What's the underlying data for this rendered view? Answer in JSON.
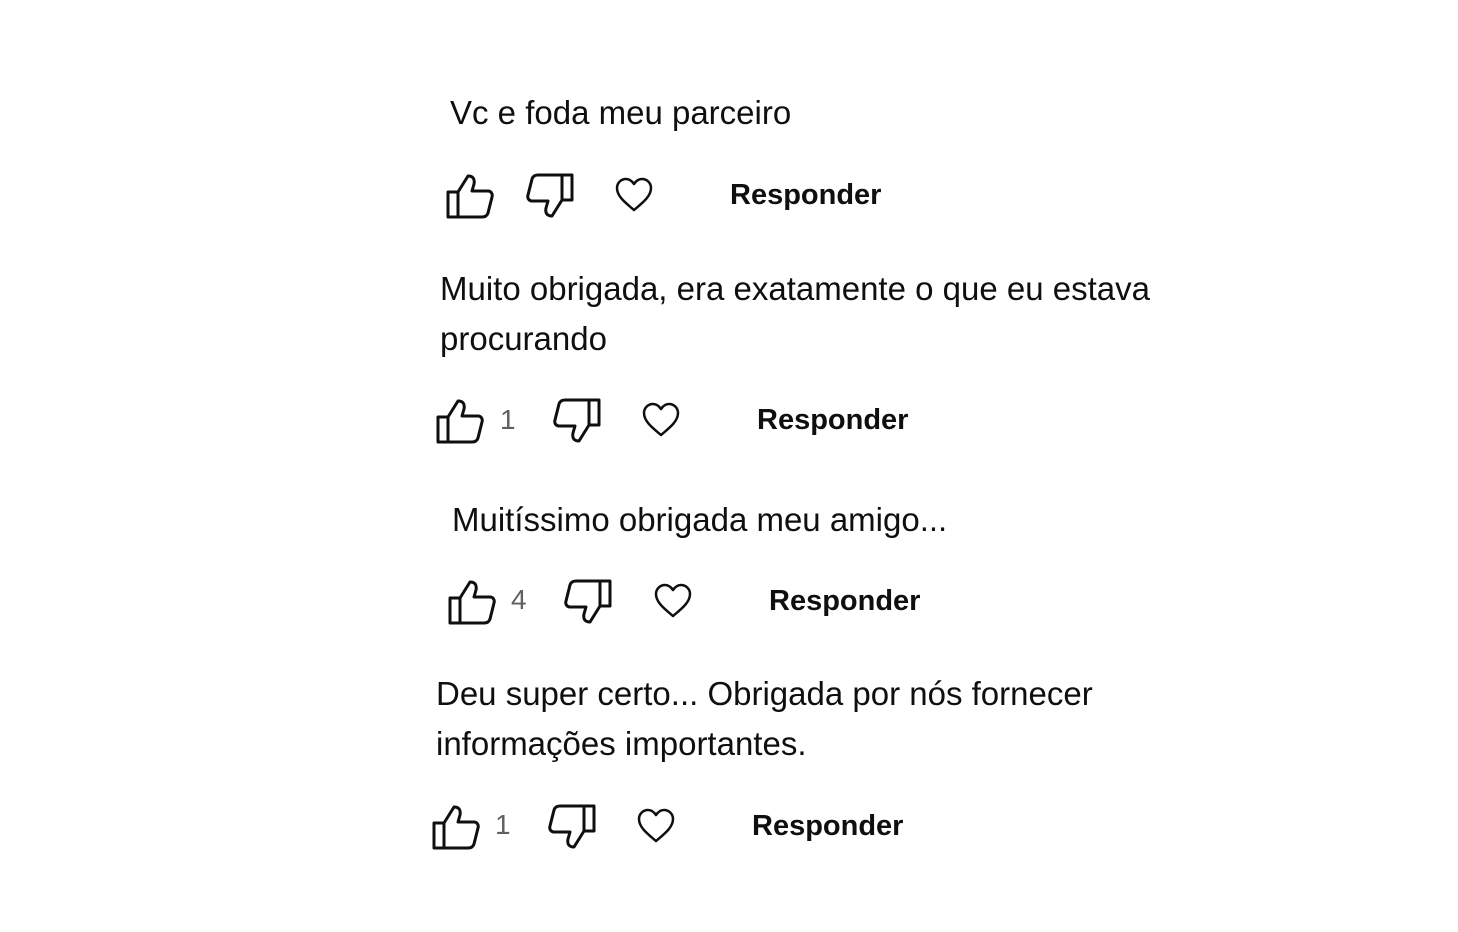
{
  "comments": [
    {
      "text_lines": [
        "Vc e foda meu parceiro"
      ],
      "like_count": "",
      "reply_label": "Responder"
    },
    {
      "text_lines": [
        "Muito obrigada, era exatamente o que eu estava",
        "procurando"
      ],
      "like_count": "1",
      "reply_label": "Responder"
    },
    {
      "text_lines": [
        "Muitíssimo obrigada meu amigo..."
      ],
      "like_count": "4",
      "reply_label": "Responder"
    },
    {
      "text_lines": [
        "Deu super certo... Obrigada por nós fornecer",
        "informações importantes."
      ],
      "like_count": "1",
      "reply_label": "Responder"
    }
  ],
  "icons": {
    "like": "thumbs-up-icon",
    "dislike": "thumbs-down-icon",
    "heart": "heart-icon"
  }
}
